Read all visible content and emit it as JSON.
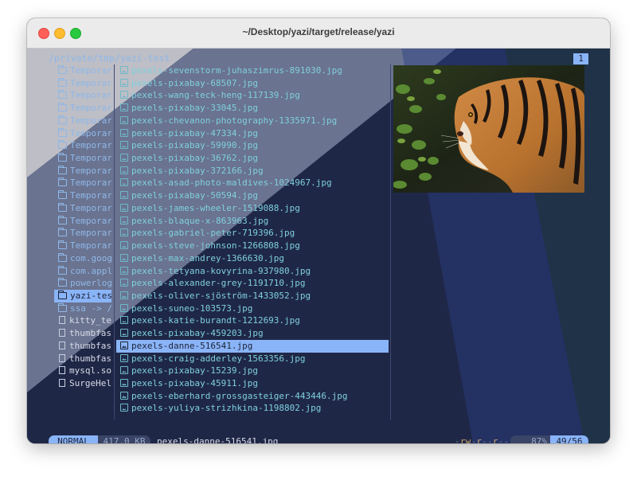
{
  "window": {
    "title": "~/Desktop/yazi/target/release/yazi"
  },
  "header": {
    "path": "/private/tmp/yazi-test",
    "tab": "1"
  },
  "parent_items": [
    {
      "name": "Temporar",
      "kind": "dir",
      "icon": "folder-icon"
    },
    {
      "name": "Temporar",
      "kind": "dir",
      "icon": "folder-icon"
    },
    {
      "name": "Temporar",
      "kind": "dir",
      "icon": "folder-icon"
    },
    {
      "name": "Temporar",
      "kind": "dir",
      "icon": "folder-icon"
    },
    {
      "name": "Temporar",
      "kind": "dir",
      "icon": "folder-icon"
    },
    {
      "name": "Temporar",
      "kind": "dir",
      "icon": "folder-icon"
    },
    {
      "name": "Temporar",
      "kind": "dir",
      "icon": "folder-icon"
    },
    {
      "name": "Temporar",
      "kind": "dir",
      "icon": "folder-icon"
    },
    {
      "name": "Temporar",
      "kind": "dir",
      "icon": "folder-icon"
    },
    {
      "name": "Temporar",
      "kind": "dir",
      "icon": "folder-icon"
    },
    {
      "name": "Temporar",
      "kind": "dir",
      "icon": "folder-icon"
    },
    {
      "name": "Temporar",
      "kind": "dir",
      "icon": "folder-icon"
    },
    {
      "name": "Temporar",
      "kind": "dir",
      "icon": "folder-icon"
    },
    {
      "name": "Temporar",
      "kind": "dir",
      "icon": "folder-icon"
    },
    {
      "name": "Temporar",
      "kind": "dir",
      "icon": "folder-icon"
    },
    {
      "name": "com.goog",
      "kind": "dir",
      "icon": "folder-icon"
    },
    {
      "name": "com.appl",
      "kind": "dir",
      "icon": "folder-icon"
    },
    {
      "name": "powerlog",
      "kind": "dir",
      "icon": "folder-icon"
    },
    {
      "name": "yazi-tes",
      "kind": "dir",
      "icon": "folder-icon",
      "selected": true
    },
    {
      "name": "ssa -> /",
      "kind": "dir",
      "icon": "folder-icon"
    },
    {
      "name": "kitty_te",
      "kind": "file",
      "icon": "file-icon"
    },
    {
      "name": "thumbfas",
      "kind": "file",
      "icon": "file-icon"
    },
    {
      "name": "thumbfas",
      "kind": "file",
      "icon": "file-icon"
    },
    {
      "name": "thumbfas",
      "kind": "file",
      "icon": "file-icon"
    },
    {
      "name": "mysql.so",
      "kind": "file",
      "icon": "file-icon"
    },
    {
      "name": "SurgeHel",
      "kind": "file",
      "icon": "file-icon"
    }
  ],
  "current_items": [
    "pexels-sevenstorm-juhaszimrus-891030.jpg",
    "pexels-pixabay-68507.jpg",
    "pexels-wang-teck-heng-117139.jpg",
    "pexels-pixabay-33045.jpg",
    "pexels-chevanon-photography-1335971.jpg",
    "pexels-pixabay-47334.jpg",
    "pexels-pixabay-59990.jpg",
    "pexels-pixabay-36762.jpg",
    "pexels-pixabay-372166.jpg",
    "pexels-asad-photo-maldives-1024967.jpg",
    "pexels-pixabay-50594.jpg",
    "pexels-james-wheeler-1519088.jpg",
    "pexels-blaque-x-863963.jpg",
    "pexels-gabriel-peter-719396.jpg",
    "pexels-steve-johnson-1266808.jpg",
    "pexels-max-andrey-1366630.jpg",
    "pexels-tetyana-kovyrina-937980.jpg",
    "pexels-alexander-grey-1191710.jpg",
    "pexels-oliver-sjöström-1433052.jpg",
    "pexels-suneo-103573.jpg",
    "pexels-katie-burandt-1212693.jpg",
    "pexels-pixabay-459203.jpg",
    "pexels-danne-516541.jpg",
    "pexels-craig-adderley-1563356.jpg",
    "pexels-pixabay-15239.jpg",
    "pexels-pixabay-45911.jpg",
    "pexels-eberhard-grossgasteiger-443446.jpg",
    "pexels-yuliya-strizhkina-1198802.jpg"
  ],
  "selected_index": 22,
  "preview": {
    "subject": "tiger-image"
  },
  "status": {
    "mode": "NORMAL",
    "size": "417.0 KB",
    "filename": "pexels-danne-516541.jpg",
    "perm_prefix": "-",
    "perm_rw": "rw",
    "perm_dash1": "-",
    "perm_r1": "r",
    "perm_dash2": "--",
    "perm_r2": "r",
    "perm_dash3": "--",
    "percent": "87%",
    "position": "49/56"
  },
  "colors": {
    "accent": "#8ab4f8",
    "background": "#1f2747",
    "directory": "#8fb8e8",
    "image_file": "#7fd0dc"
  }
}
